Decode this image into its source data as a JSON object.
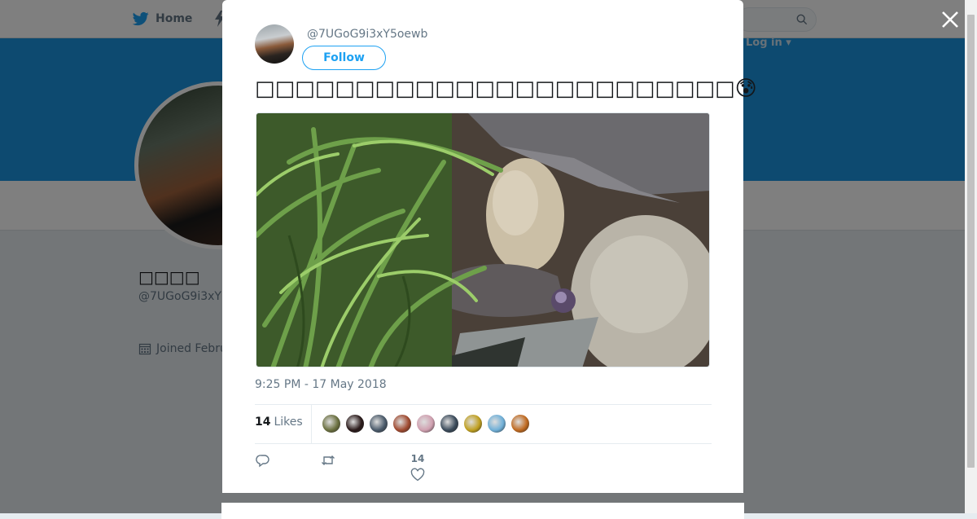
{
  "nav": {
    "home_label": "Home",
    "login_label": "Log in ▾"
  },
  "profile": {
    "name": "□□□□",
    "handle": "@7UGoG9i3xY",
    "joined": "Joined Febru"
  },
  "tweet": {
    "handle": "@7UGoG9i3xY5oewb",
    "follow_label": "Follow",
    "text": "□□□□□□□□□□□□□□□□□□□□□□□□😰",
    "timestamp": "9:25 PM - 17 May 2018",
    "likes_count": "14",
    "likes_label": "Likes",
    "like_action_count": "14"
  },
  "colors": {
    "brand": "#1da1f2",
    "banner": "#1b95e0",
    "text_secondary": "#657786"
  },
  "likers": [
    "#6b7040",
    "#2a1a1a",
    "#4a5a6a",
    "#a04a30",
    "#d0a0b0",
    "#3a4a5a",
    "#c0a020",
    "#70b0d8",
    "#c06a20"
  ]
}
